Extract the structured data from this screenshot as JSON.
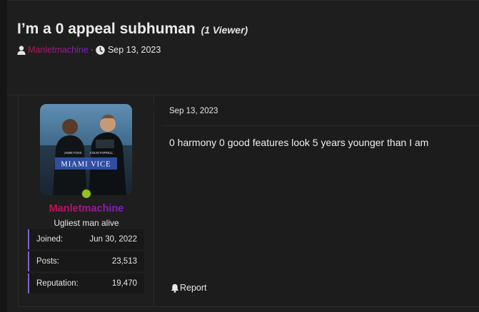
{
  "thread": {
    "title": "I’m a 0 appeal subhuman",
    "viewers": "(1 Viewer)",
    "author": "Manletmachine",
    "separator": "·",
    "date": "Sep 13, 2023"
  },
  "post": {
    "user": {
      "name": "Manletmachine",
      "title": "Ugliest man alive",
      "online": true,
      "avatar_text": {
        "caption": "MIAMI VICE",
        "actor_left": "JAMIE FOXX",
        "actor_right": "COLIN FARRELL"
      },
      "stats": [
        {
          "label": "Joined:",
          "value": "Jun 30, 2022"
        },
        {
          "label": "Posts:",
          "value": "23,513"
        },
        {
          "label": "Reputation:",
          "value": "19,470"
        }
      ]
    },
    "date": "Sep 13, 2023",
    "body": "0 harmony 0 good features look 5 years younger than I am",
    "report_label": "Report"
  },
  "colors": {
    "background": "#1b1b1b",
    "username_gradient_start": "#c0124a",
    "username_gradient_end": "#7b22c8",
    "online_indicator": "#8fc31d",
    "stat_accent": "#7c63c7"
  },
  "icons": {
    "author": "user-icon",
    "date": "clock-icon",
    "report": "bell-icon"
  }
}
